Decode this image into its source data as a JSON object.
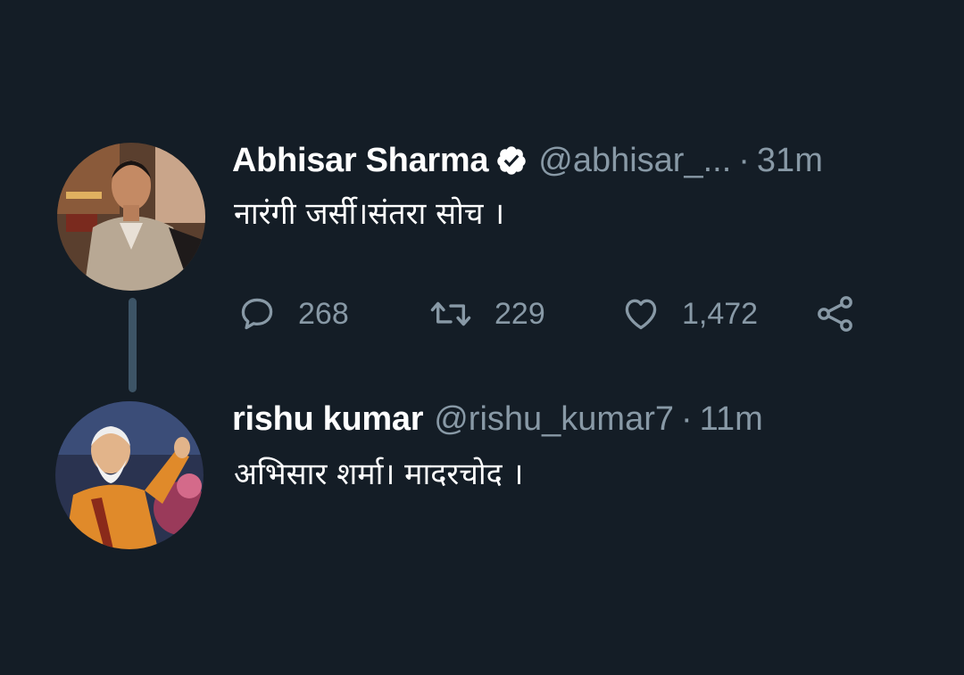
{
  "thread": {
    "tweets": [
      {
        "name": "Abhisar Sharma",
        "verified": true,
        "handle": "@abhisar_...",
        "separator": "·",
        "time": "31m",
        "text": "नारंगी जर्सी।संतरा सोच ।",
        "actions": {
          "reply_count": "268",
          "retweet_count": "229",
          "like_count": "1,472"
        },
        "avatar_icon": "person-avatar-icon"
      },
      {
        "name": "rishu kumar",
        "verified": false,
        "handle": "@rishu_kumar7",
        "separator": "·",
        "time": "11m",
        "text": "अभिसार शर्मा।  मादरचोद ।",
        "avatar_icon": "person-avatar-icon"
      }
    ]
  },
  "colors": {
    "background": "#141d26",
    "primary_text": "#ffffff",
    "secondary_text": "#8899a6",
    "thread_line": "#3d5466"
  },
  "icons": [
    "reply-icon",
    "retweet-icon",
    "like-icon",
    "share-icon",
    "verified-badge-icon"
  ]
}
